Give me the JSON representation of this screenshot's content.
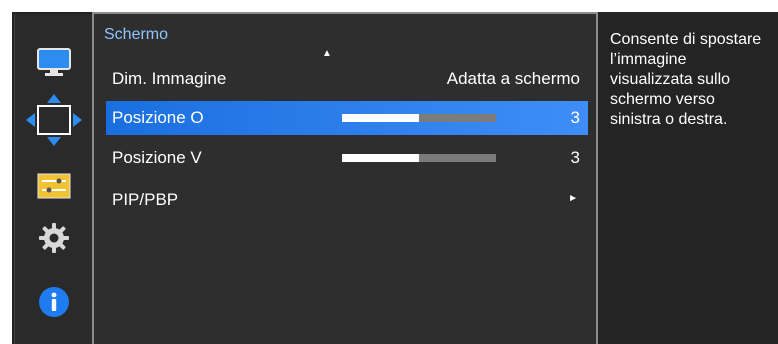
{
  "icons": [
    "monitor-icon",
    "move-arrows-icon",
    "settings-sliders-icon",
    "gear-icon",
    "info-icon"
  ],
  "colors": {
    "accent": "#3f8df7",
    "title": "#8fc4ff",
    "background": "#222222",
    "panel_border": "#8c8c8c"
  },
  "menu": {
    "title": "Schermo",
    "scroll_indicator": "▲",
    "items": [
      {
        "label": "Dim. Immagine",
        "value": "Adatta a schermo"
      },
      {
        "label": "Posizione O",
        "value": "3",
        "level": 0.5
      },
      {
        "label": "Posizione V",
        "value": "3",
        "level": 0.5
      },
      {
        "label": "PIP/PBP",
        "value": "►"
      }
    ]
  },
  "description": "Consente di spostare l’immagine visualizzata sullo schermo verso sinistra o destra."
}
